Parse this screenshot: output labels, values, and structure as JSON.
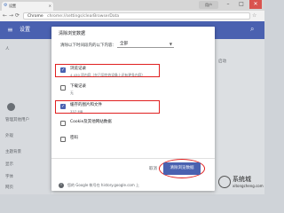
{
  "browser": {
    "tab_title": "设置",
    "user_button": "用户",
    "omnibox": {
      "prefix": "Chrome",
      "url": "chrome://settings/clearBrowserData"
    }
  },
  "settings": {
    "title": "设置",
    "background_labels": [
      "人",
      "管理其他用户",
      "外观",
      "主题背景",
      "显示",
      "字体",
      "网页",
      "启动"
    ]
  },
  "dialog": {
    "title": "清除浏览数据",
    "range_label": "清除以下时间段内的以下内容：",
    "range_value": "全部",
    "items": [
      {
        "label": "浏览记录",
        "desc": "4,430 项内容（在已同步的设备上还有更多内容）",
        "checked": true,
        "highlighted": true
      },
      {
        "label": "下载记录",
        "desc": "无",
        "checked": false,
        "highlighted": false
      },
      {
        "label": "缓存的图片和文件",
        "desc": "337 MB",
        "checked": true,
        "highlighted": true
      },
      {
        "label": "Cookie及其他网站数据",
        "desc": "",
        "checked": false,
        "highlighted": false
      },
      {
        "label": "密码",
        "desc": "",
        "checked": false,
        "highlighted": false
      }
    ],
    "cancel_label": "取消",
    "clear_label": "清除浏览数据",
    "info_text": "您的 Google 帐号在 history.google.com 上"
  },
  "watermark": {
    "line1": "系统城",
    "line2": "xitongcheng.com"
  },
  "colors": {
    "accent": "#4a61b0",
    "highlight": "#e02020",
    "header": "#4a61b0"
  }
}
